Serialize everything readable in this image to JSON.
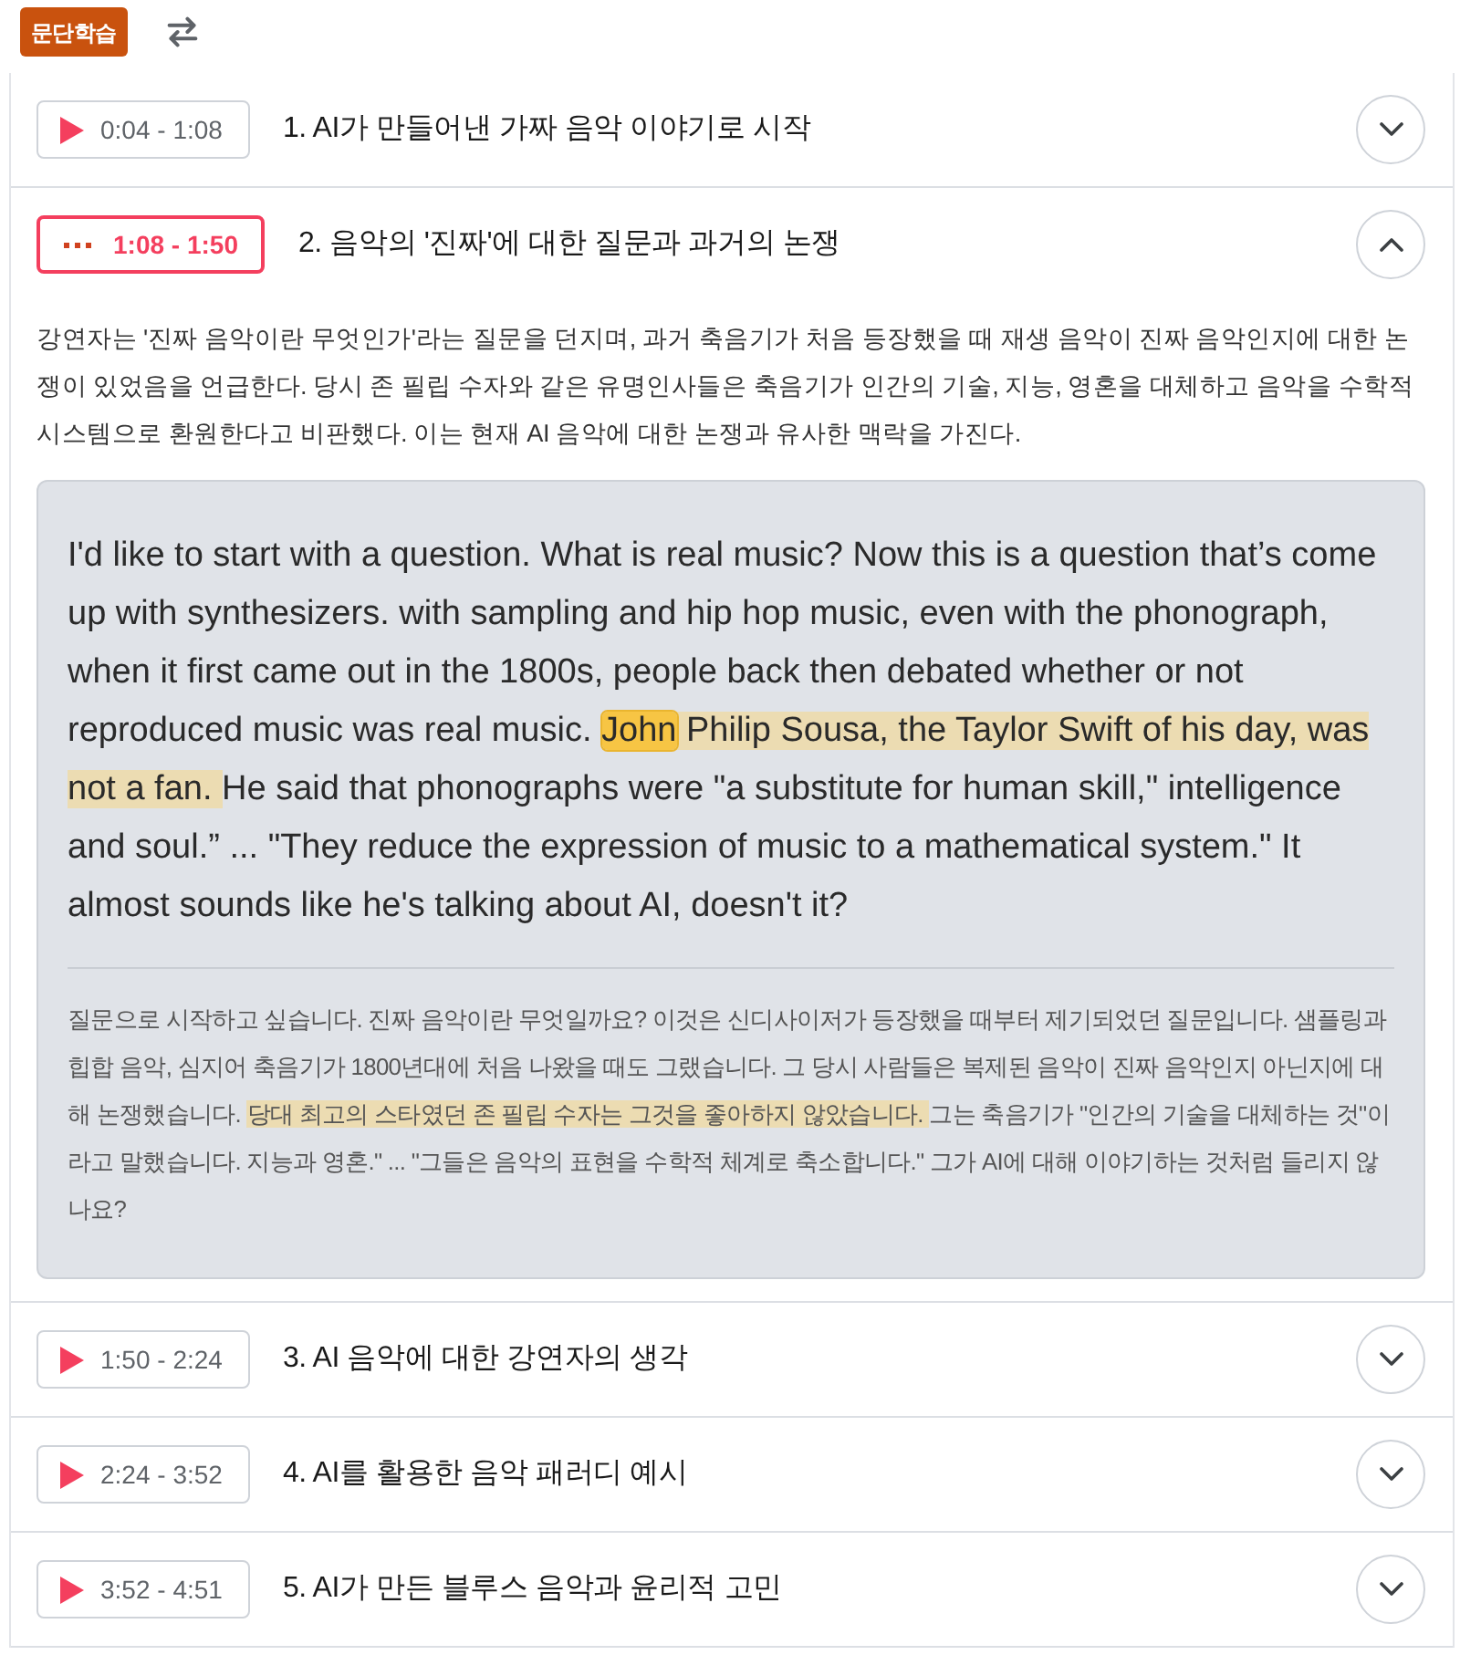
{
  "header": {
    "badge": "문단학습"
  },
  "sections": [
    {
      "time": "0:04 - 1:08",
      "title": "1. AI가 만들어낸 가짜 음악 이야기로 시작",
      "playing": false,
      "expanded": false
    },
    {
      "time": "1:08 - 1:50",
      "title": "2. 음악의 '진짜'에 대한 질문과 과거의 논쟁",
      "playing": true,
      "expanded": true,
      "summary": "강연자는 '진짜 음악이란 무엇인가'라는 질문을 던지며, 과거 축음기가 처음 등장했을 때 재생 음악이 진짜 음악인지에 대한 논쟁이 있었음을 언급한다. 당시 존 필립 수자와 같은 유명인사들은 축음기가 인간의 기술, 지능, 영혼을 대체하고 음악을 수학적 시스템으로 환원한다고 비판했다. 이는 현재 AI 음악에 대한 논쟁과 유사한 맥락을 가진다.",
      "transcript": [
        {
          "kind": "plain",
          "text": "I'd like to start with a question. What is real music? Now this is a question that’s come up with synthesizers. with sampling and hip hop music, even with the phonograph, when it first came out in the 1800s, people back then debated whether or not reproduced music was real music. "
        },
        {
          "kind": "word",
          "text": "John"
        },
        {
          "kind": "sentence",
          "text": " Philip Sousa, the Taylor Swift of his day, was not a fan. "
        },
        {
          "kind": "plain",
          "text": "He said that phonographs were \"a substitute for human skill,\" intelligence and soul.” ... \"They reduce the expression of music to a mathematical system.\" It almost sounds like he's talking about AI, doesn't it?"
        }
      ],
      "translation": [
        {
          "kind": "plain",
          "text": "질문으로 시작하고 싶습니다. 진짜 음악이란 무엇일까요? 이것은 신디사이저가 등장했을 때부터 제기되었던 질문입니다. 샘플링과 힙합 음악, 심지어 축음기가 1800년대에 처음 나왔을 때도 그랬습니다. 그 당시 사람들은 복제된 음악이 진짜 음악인지 아닌지에 대해 논쟁했습니다. "
        },
        {
          "kind": "sentence",
          "text": "당대 최고의 스타였던 존 필립 수자는 그것을 좋아하지 않았습니다. "
        },
        {
          "kind": "plain",
          "text": "그는 축음기가 \"인간의 기술을 대체하는 것\"이라고 말했습니다. 지능과 영혼.\" ... \"그들은 음악의 표현을 수학적 체계로 축소합니다.\" 그가 AI에 대해 이야기하는 것처럼 들리지 않나요?"
        }
      ]
    },
    {
      "time": "1:50 - 2:24",
      "title": "3. AI 음악에 대한 강연자의 생각",
      "playing": false,
      "expanded": false
    },
    {
      "time": "2:24 - 3:52",
      "title": "4. AI를 활용한 음악 패러디 예시",
      "playing": false,
      "expanded": false
    },
    {
      "time": "3:52 - 4:51",
      "title": "5. AI가 만든 블루스 음악과 윤리적 고민",
      "playing": false,
      "expanded": false
    }
  ]
}
